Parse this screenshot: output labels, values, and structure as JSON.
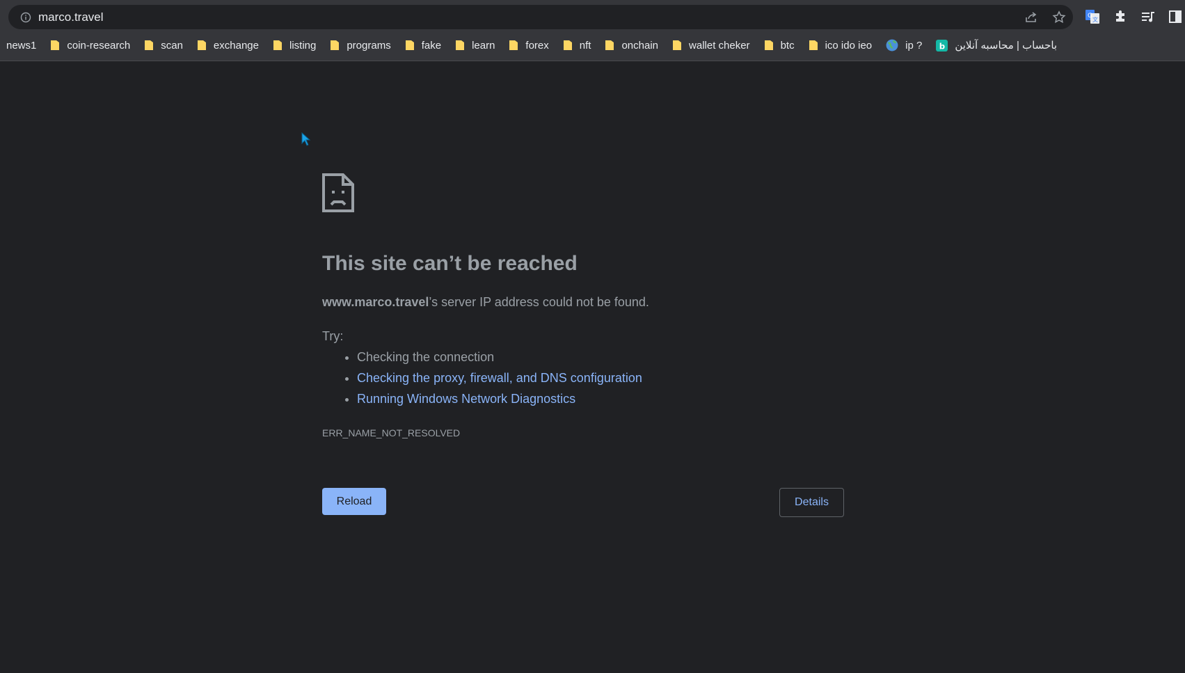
{
  "browser": {
    "url": "marco.travel",
    "bookmarks": [
      {
        "label": "news1",
        "icon": "none"
      },
      {
        "label": "coin-research",
        "icon": "folder-icon"
      },
      {
        "label": "scan",
        "icon": "folder-icon"
      },
      {
        "label": "exchange",
        "icon": "folder-icon"
      },
      {
        "label": "listing",
        "icon": "folder-icon"
      },
      {
        "label": "programs",
        "icon": "folder-icon"
      },
      {
        "label": "fake",
        "icon": "folder-icon"
      },
      {
        "label": "learn",
        "icon": "folder-icon"
      },
      {
        "label": "forex",
        "icon": "folder-icon"
      },
      {
        "label": "nft",
        "icon": "folder-icon"
      },
      {
        "label": "onchain",
        "icon": "folder-icon"
      },
      {
        "label": "wallet cheker",
        "icon": "folder-icon"
      },
      {
        "label": "btc",
        "icon": "folder-icon"
      },
      {
        "label": "ico ido ieo",
        "icon": "folder-icon"
      },
      {
        "label": "ip ?",
        "icon": "globe-icon"
      },
      {
        "label": "باحساب | محاسبه آنلاین",
        "icon": "site-b-icon"
      }
    ],
    "colors": {
      "toolbar": "#35363a",
      "page": "#202124",
      "folder": "#fdd663",
      "link": "#8ab4f8"
    }
  },
  "error_page": {
    "title": "This site can’t be reached",
    "host": "www.marco.travel",
    "summary_rest": "’s server IP address could not be found.",
    "try_label": "Try:",
    "suggestions": [
      "Checking the connection",
      "Checking the proxy, firewall, and DNS configuration",
      "Running Windows Network Diagnostics"
    ],
    "error_code": "ERR_NAME_NOT_RESOLVED",
    "reload_label": "Reload",
    "details_label": "Details"
  }
}
